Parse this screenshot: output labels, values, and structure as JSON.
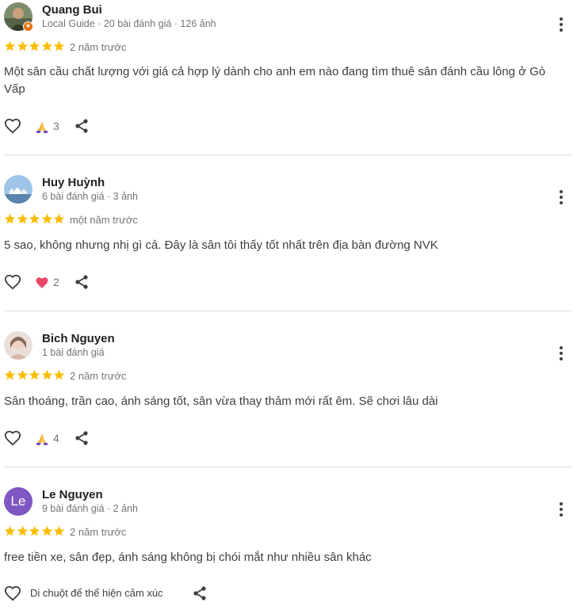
{
  "reviews": [
    {
      "name": "Quang Bui",
      "meta": "Local Guide · 20 bài đánh giá · 126 ảnh",
      "stars": 5,
      "when": "2 năm trước",
      "text": "Một sân cầu chất lượng với giá cả hợp lý dành cho anh em nào đang tìm thuê sân đánh cầu lông ở Gò Vấp",
      "reaction_icon": "praying-hands-icon",
      "reaction_count": "3"
    },
    {
      "name": "Huy Huỳnh",
      "meta": "6 bài đánh giá · 3 ảnh",
      "stars": 5,
      "when": "một năm trước",
      "text": "5 sao, không nhưng nhị gì cả. Đây là sân tôi thấy tốt nhất trên địa bàn đường NVK",
      "reaction_icon": "heart-icon",
      "reaction_count": "2"
    },
    {
      "name": "Bich Nguyen",
      "meta": "1 bài đánh giá",
      "stars": 5,
      "when": "2 năm trước",
      "text": "Sân thoáng, trần cao, ánh sáng tốt, sân vừa thay thảm mới rất êm. Sẽ chơi lâu dài",
      "reaction_icon": "praying-hands-icon",
      "reaction_count": "4"
    },
    {
      "name": "Le Nguyen",
      "avatar_initials": "Le",
      "meta": "9 bài đánh giá · 2 ảnh",
      "stars": 5,
      "when": "2 năm trước",
      "text": "free tiền xe, sân đẹp, ánh sáng không bị chói mắt như nhiều sân khác",
      "hint": "Di chuột để thể hiện cảm xúc"
    }
  ],
  "colors": {
    "star": "#fbbc04",
    "meta_text": "#70757a",
    "body_text": "#3c4043",
    "divider": "#dadce0",
    "initials_avatar": "#7e57c2",
    "heart": "#e8496a",
    "local_guide_badge": "#e8710a"
  }
}
